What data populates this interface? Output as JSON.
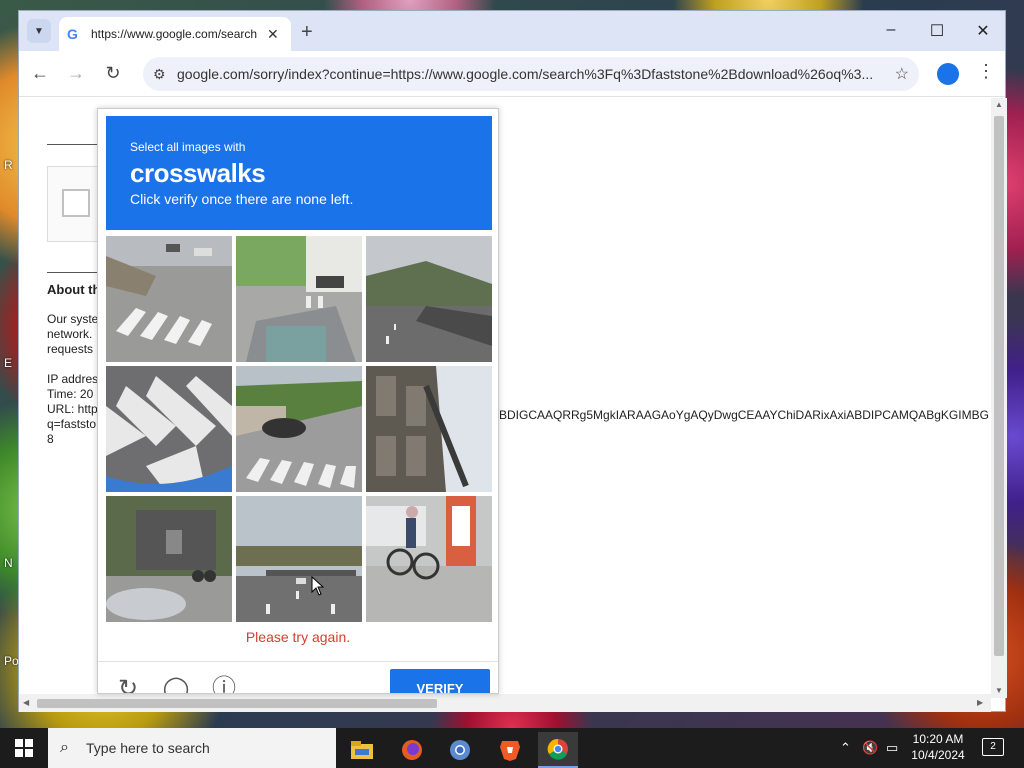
{
  "browser": {
    "tab_title": "https://www.google.com/search",
    "url": "google.com/sorry/index?continue=https://www.google.com/search%3Fq%3Dfaststone%2Bdownload%26oq%3...",
    "window_controls": {
      "minimize": "–",
      "maximize": "☐",
      "close": "✕"
    }
  },
  "page": {
    "about_heading": "About th",
    "para_lines": [
      "Our syste",
      "network.",
      "requests"
    ],
    "info_lines": [
      "IP addres",
      "Time: 20",
      "URL: http",
      "q=faststo",
      "8"
    ],
    "url_overflow": "BDIGCAAQRRg5MgkIARAAGAoYgAQyDwgCEAAYChiDARixAxiABDIPCAMQABgKGIMBGLEDGIAE"
  },
  "captcha": {
    "prompt_line1": "Select all images with",
    "prompt_word": "crosswalks",
    "prompt_line2": "Click verify once there are none left.",
    "error": "Please try again.",
    "verify_label": "VERIFY",
    "tiles": [
      {
        "name": "tile-1",
        "desc": "crosswalk stairs"
      },
      {
        "name": "tile-2",
        "desc": "street crosswalk"
      },
      {
        "name": "tile-3",
        "desc": "road bridge"
      },
      {
        "name": "tile-4",
        "desc": "crosswalk closeup"
      },
      {
        "name": "tile-5",
        "desc": "street crosswalk car"
      },
      {
        "name": "tile-6",
        "desc": "building facade"
      },
      {
        "name": "tile-7",
        "desc": "building cyclist"
      },
      {
        "name": "tile-8",
        "desc": "highway"
      },
      {
        "name": "tile-9",
        "desc": "cyclist street"
      }
    ]
  },
  "desktop_labels": [
    "R",
    "E",
    "N",
    "Po"
  ],
  "taskbar": {
    "search_placeholder": "Type here to search",
    "time": "10:20 AM",
    "date": "10/4/2024",
    "notifications": "2"
  }
}
